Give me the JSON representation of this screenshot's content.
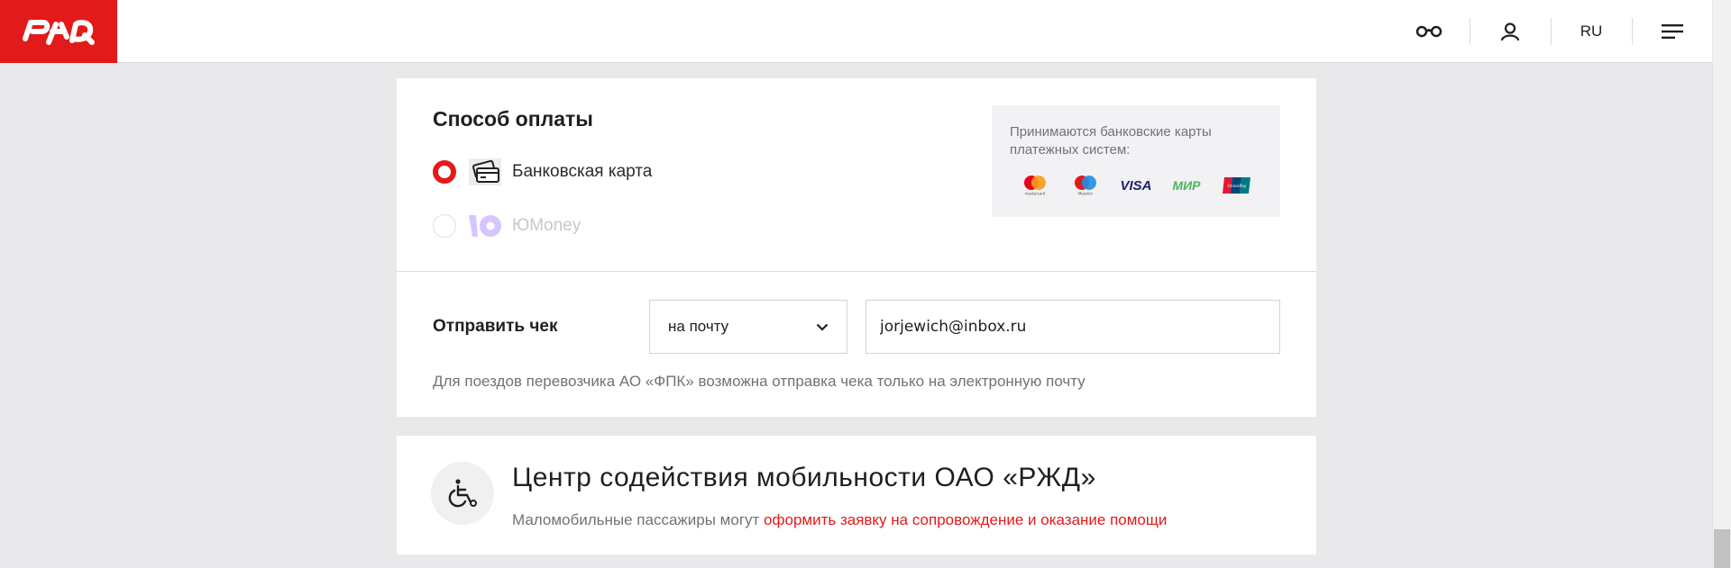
{
  "header": {
    "logo_text": "РЖД",
    "lang": "RU",
    "icons": [
      "glasses-icon",
      "user-icon",
      "menu-icon"
    ]
  },
  "payment": {
    "title": "Способ оплаты",
    "options": [
      {
        "label": "Банковская карта",
        "selected": true,
        "icon": "card-icon"
      },
      {
        "label": "ЮMoney",
        "selected": false,
        "disabled": true,
        "icon": "yoomoney-icon"
      }
    ],
    "accepted_text": "Принимаются банковские карты платежных систем:",
    "card_logos": [
      {
        "name": "mastercard",
        "label": "mastercard"
      },
      {
        "name": "maestro",
        "label": "Maestro"
      },
      {
        "name": "visa",
        "label": "VISA"
      },
      {
        "name": "mir",
        "label": "МИР"
      },
      {
        "name": "unionpay",
        "label": "UnionPay"
      }
    ]
  },
  "receipt": {
    "label": "Отправить чек",
    "select_value": "на почту",
    "email_value": "jorjewich@inbox.ru",
    "note": "Для поездов перевозчика АО «ФПК» возможна отправка чека только на электронную почту"
  },
  "mobility": {
    "title": "Центр содействия мобильности ОАО «РЖД»",
    "subtitle_prefix": "Маломобильные пассажиры могут ",
    "link_text": "оформить заявку на сопровождение и оказание помощи"
  },
  "colors": {
    "brand": "#e21a1a",
    "background": "#e9e9ec",
    "muted": "#6f7378"
  }
}
